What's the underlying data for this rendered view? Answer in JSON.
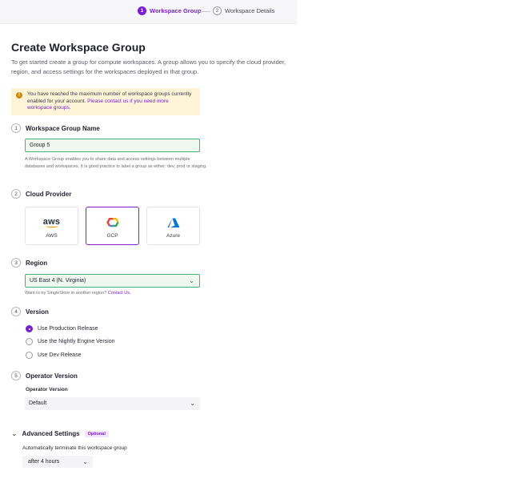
{
  "stepper": {
    "step1": {
      "num": "1",
      "label": "Workspace Group"
    },
    "step2": {
      "num": "2",
      "label": "Workspace Details"
    }
  },
  "title": "Create Workspace Group",
  "intro": "To get started create a group for compute workspaces. A group allows you to specify the cloud provider, region, and access settings for the workspaces deployed in that group.",
  "alert": {
    "icon": "warning-icon",
    "text": "You have reached the maximum number of workspace groups currently enabled for your account.",
    "link": "Please contact us if you need more workspace groups."
  },
  "sections": {
    "name": {
      "num": "1",
      "title": "Workspace Group Name",
      "value": "Group 5",
      "help": "A Workspace Group enables you to share data and access settings between multiple databases and workspaces. It is good practice to label a group as either: dev, prod or staging."
    },
    "cloud": {
      "num": "2",
      "title": "Cloud Provider",
      "providers": [
        {
          "label": "AWS",
          "logo_text": "aws",
          "icon": "aws-logo-icon",
          "selected": false
        },
        {
          "label": "GCP",
          "icon": "gcp-logo-icon",
          "selected": true
        },
        {
          "label": "Azure",
          "icon": "azure-logo-icon",
          "selected": false
        }
      ]
    },
    "region": {
      "num": "3",
      "title": "Region",
      "value": "US East 4 (N. Virginia)",
      "help": "Want to try SingleStore in another region?",
      "help_link": "Contact Us."
    },
    "version": {
      "num": "4",
      "title": "Version",
      "options": [
        {
          "label": "Use Production Release",
          "selected": true
        },
        {
          "label": "Use the Nightly Engine Version",
          "selected": false
        },
        {
          "label": "Use Dev Release",
          "selected": false
        }
      ]
    },
    "operator": {
      "num": "5",
      "title": "Operator Version",
      "field_label": "Operator Version",
      "value": "Default"
    }
  },
  "advanced": {
    "title": "Advanced Settings",
    "badge": "Optional",
    "terminate_label": "Automatically terminate this workspace group",
    "terminate_value": "after 4 hours"
  },
  "colors": {
    "accent": "#7a1ed6",
    "valid_border": "#4caf7a",
    "alert_bg": "#fdf4d7"
  }
}
